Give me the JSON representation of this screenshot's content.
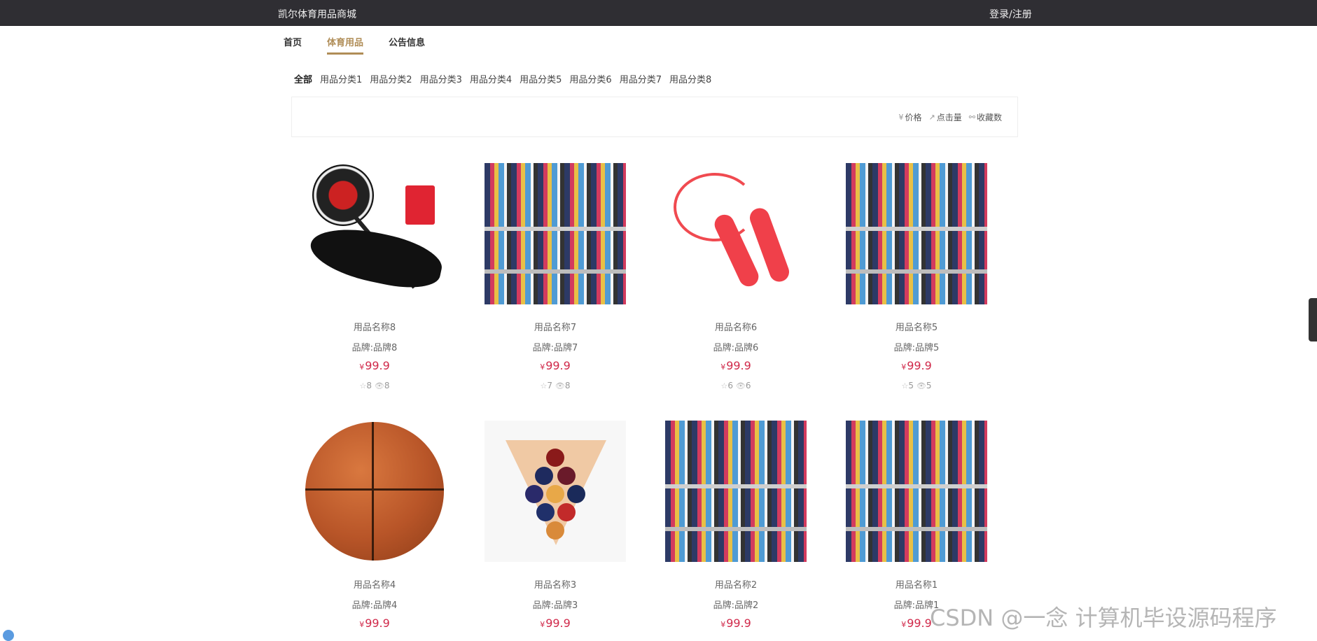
{
  "header": {
    "site_name": "凯尔体育用品商城",
    "login_link": "登录/注册"
  },
  "nav": [
    {
      "label": "首页",
      "active": false
    },
    {
      "label": "体育用品",
      "active": true
    },
    {
      "label": "公告信息",
      "active": false
    }
  ],
  "categories": [
    {
      "label": "全部",
      "active": true
    },
    {
      "label": "用品分类1"
    },
    {
      "label": "用品分类2"
    },
    {
      "label": "用品分类3"
    },
    {
      "label": "用品分类4"
    },
    {
      "label": "用品分类5"
    },
    {
      "label": "用品分类6"
    },
    {
      "label": "用品分类7"
    },
    {
      "label": "用品分类8"
    }
  ],
  "sort_options": [
    {
      "icon": "¥",
      "label": "价格"
    },
    {
      "icon": "↗",
      "label": "点击量"
    },
    {
      "icon": "⚯",
      "label": "收藏数"
    }
  ],
  "products": [
    {
      "name": "用品名称8",
      "brand": "品牌:品牌8",
      "price": "99.9",
      "favorites": "8",
      "views": "8",
      "image": "racket"
    },
    {
      "name": "用品名称7",
      "brand": "品牌:品牌7",
      "price": "99.9",
      "favorites": "7",
      "views": "8",
      "image": "shelf"
    },
    {
      "name": "用品名称6",
      "brand": "品牌:品牌6",
      "price": "99.9",
      "favorites": "6",
      "views": "6",
      "image": "jump-rope"
    },
    {
      "name": "用品名称5",
      "brand": "品牌:品牌5",
      "price": "99.9",
      "favorites": "5",
      "views": "5",
      "image": "shelf"
    },
    {
      "name": "用品名称4",
      "brand": "品牌:品牌4",
      "price": "99.9",
      "favorites": "",
      "views": "",
      "image": "basketball"
    },
    {
      "name": "用品名称3",
      "brand": "品牌:品牌3",
      "price": "99.9",
      "favorites": "",
      "views": "",
      "image": "billiards"
    },
    {
      "name": "用品名称2",
      "brand": "品牌:品牌2",
      "price": "99.9",
      "favorites": "",
      "views": "",
      "image": "shelf"
    },
    {
      "name": "用品名称1",
      "brand": "品牌:品牌1",
      "price": "99.9",
      "favorites": "",
      "views": "",
      "image": "shelf"
    }
  ],
  "currency_symbol": "¥",
  "watermark": "CSDN @一念 计算机毕设源码程序",
  "colors": {
    "topbar": "#2f2e33",
    "accent": "#b08d57",
    "price": "#d0294a"
  }
}
